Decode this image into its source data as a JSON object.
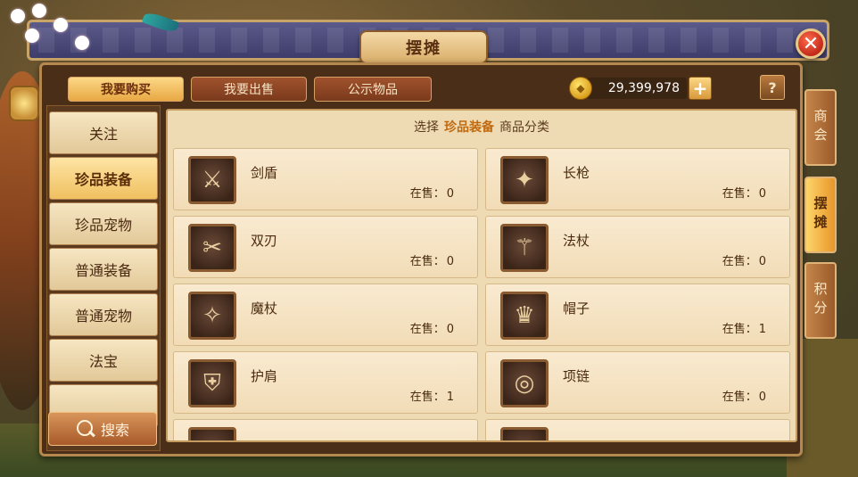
{
  "window": {
    "title": "摆摊",
    "close_glyph": "✕"
  },
  "top_tabs": [
    {
      "label": "我要购买",
      "active": true
    },
    {
      "label": "我要出售",
      "active": false
    },
    {
      "label": "公示物品",
      "active": false
    }
  ],
  "currency": {
    "icon": "coin-icon",
    "value": "29,399,978",
    "add_glyph": "+"
  },
  "help_label": "?",
  "sidebar": {
    "items": [
      {
        "label": "关注",
        "active": false
      },
      {
        "label": "珍品装备",
        "active": true
      },
      {
        "label": "珍品宠物",
        "active": false
      },
      {
        "label": "普通装备",
        "active": false
      },
      {
        "label": "普通宠物",
        "active": false
      },
      {
        "label": "法宝",
        "active": false
      }
    ],
    "search_label": "搜索"
  },
  "breadcrumb": {
    "prefix": "选择",
    "category": "珍品装备",
    "suffix": "商品分类"
  },
  "stock_label": "在售：",
  "items": [
    {
      "name": "剑盾",
      "stock": "0",
      "icon": "sword-shield-icon",
      "glyph": "⚔"
    },
    {
      "name": "长枪",
      "stock": "0",
      "icon": "spear-icon",
      "glyph": "✦"
    },
    {
      "name": "双刃",
      "stock": "0",
      "icon": "dual-blade-icon",
      "glyph": "✂"
    },
    {
      "name": "法杖",
      "stock": "0",
      "icon": "staff-icon",
      "glyph": "⚚"
    },
    {
      "name": "魔杖",
      "stock": "0",
      "icon": "wand-icon",
      "glyph": "✧"
    },
    {
      "name": "帽子",
      "stock": "1",
      "icon": "hat-icon",
      "glyph": "♛"
    },
    {
      "name": "护肩",
      "stock": "1",
      "icon": "pauldron-icon",
      "glyph": "⛨"
    },
    {
      "name": "项链",
      "stock": "0",
      "icon": "necklace-icon",
      "glyph": "◎"
    }
  ],
  "right_tabs": [
    {
      "label": "商会",
      "active": false
    },
    {
      "label": "摆摊",
      "active": true
    },
    {
      "label": "积分",
      "active": false
    }
  ],
  "colors": {
    "accent_active": "#f0c060",
    "highlight_text": "#c06a10",
    "close_red": "#c22a1a"
  }
}
